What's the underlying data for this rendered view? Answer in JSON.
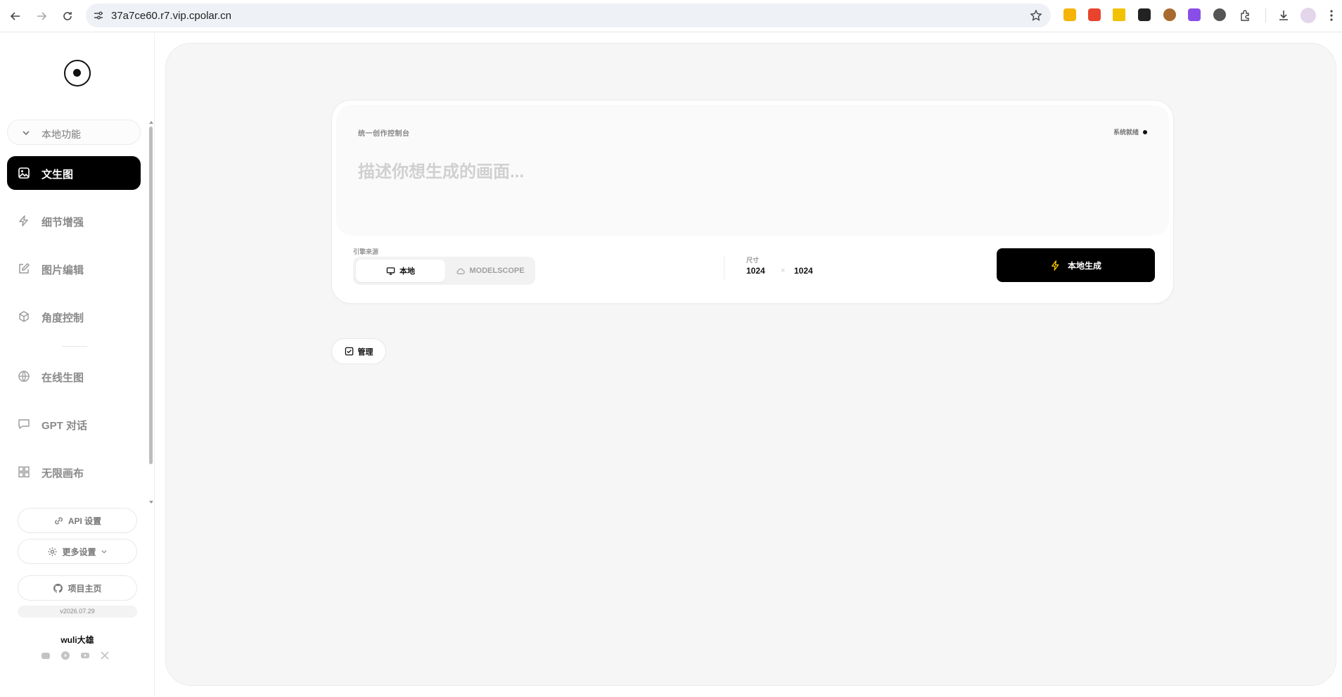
{
  "browser": {
    "url": "37a7ce60.r7.vip.cpolar.cn"
  },
  "sidebar": {
    "section_label": "本地功能",
    "items": [
      {
        "label": "文生图",
        "icon": "image-icon",
        "active": true
      },
      {
        "label": "细节增强",
        "icon": "bolt-icon",
        "active": false
      },
      {
        "label": "图片编辑",
        "icon": "edit-icon",
        "active": false
      },
      {
        "label": "角度控制",
        "icon": "cube-icon",
        "active": false
      },
      {
        "label": "在线生图",
        "icon": "globe-icon",
        "active": false
      },
      {
        "label": "GPT 对话",
        "icon": "chat-icon",
        "active": false
      },
      {
        "label": "无限画布",
        "icon": "grid-icon",
        "active": false
      }
    ],
    "api_settings": "API 设置",
    "more_settings": "更多设置",
    "project_home": "项目主页",
    "version": "v2026.07.29",
    "author": "wuli大雄"
  },
  "console": {
    "title": "统一创作控制台",
    "status": "系统就绪",
    "prompt_placeholder": "描述你想生成的画面...",
    "engine_label": "引擎来源",
    "engine_local": "本地",
    "engine_remote": "MODELSCOPE",
    "size_label": "尺寸",
    "width": "1024",
    "height": "1024",
    "size_separator": "×",
    "generate_label": "本地生成"
  },
  "manage_label": "管理",
  "colors": {
    "accent": "#000000",
    "generate_icon": "#f5c400",
    "main_bg": "#f6f6f6"
  }
}
